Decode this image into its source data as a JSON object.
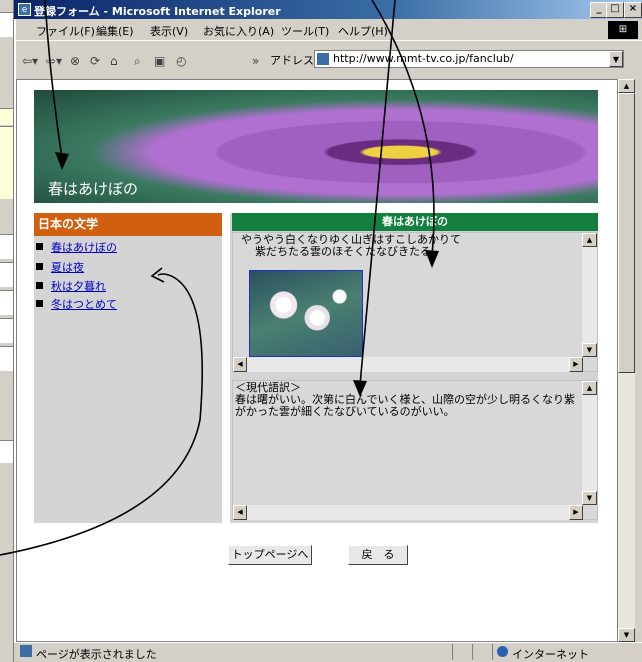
{
  "window": {
    "title": "登録フォーム - Microsoft Internet Explorer",
    "buttons": {
      "minimize": "_",
      "maximize": "□",
      "close": "×"
    }
  },
  "menubar": {
    "items": [
      "ファイル(F)",
      "編集(E)",
      "表示(V)",
      "お気に入り(A)",
      "ツール(T)",
      "ヘルプ(H)"
    ]
  },
  "toolbar": {
    "overflow": "»",
    "address_label": "アドレス(D)",
    "address_value": "http://www.mmt-tv.co.jp/fanclub/"
  },
  "banner": {
    "title": "春はあけぼの"
  },
  "leftnav": {
    "heading": "日本の文学",
    "items": [
      {
        "label": "春はあけぼの"
      },
      {
        "label": "夏は夜"
      },
      {
        "label": "秋は夕暮れ"
      },
      {
        "label": "冬はつとめて"
      }
    ]
  },
  "content": {
    "heading": "春はあけぼの",
    "original_text_line1": "やうやう白くなりゆく山ぎはすこしあかりて",
    "original_text_line2": "紫だちたる雲のほそくたなびきたる",
    "modern_heading": "＜現代語訳＞",
    "modern_text": "春は曙がいい。次第に白んでいく様と、山際の空が少し明るくなり紫がかった雲が細くたなびいているのがいい。"
  },
  "buttons": {
    "top_page": "トップページへ",
    "back": "戻　る"
  },
  "statusbar": {
    "text": "ページが表示されました",
    "zone": "インターネット"
  },
  "colors": {
    "nav_header": "#d06010",
    "content_header": "#138040",
    "titlebar": "#0a246a",
    "link": "#0000cc"
  }
}
